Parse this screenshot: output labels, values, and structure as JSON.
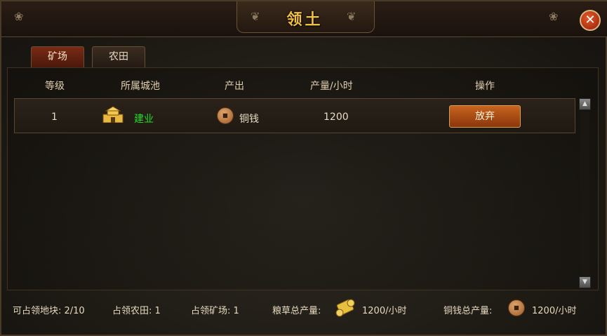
{
  "window": {
    "title": "领土",
    "close_label": "✕"
  },
  "tabs": [
    {
      "label": "矿场",
      "active": true
    },
    {
      "label": "农田",
      "active": false
    }
  ],
  "table": {
    "headers": [
      "等级",
      "所属城池",
      "产出",
      "产量/小时",
      "操作"
    ],
    "rows": [
      {
        "level": "1",
        "city": "建业",
        "output": "铜钱",
        "per_hour": "1200",
        "action": "放弃"
      }
    ]
  },
  "footer": {
    "occupiable_plots": "可占领地块: 2/10",
    "occupied_farms": "占领农田: 1",
    "occupied_mines": "占领矿场: 1",
    "grain_label": "粮草总产量:",
    "grain_value": "1200/小时",
    "copper_label": "铜钱总产量:",
    "copper_value": "1200/小时"
  },
  "colors": {
    "title": "#f2c040",
    "city_name": "#22dd22",
    "button": "#b0521a"
  },
  "icons": [
    "close-icon",
    "city-icon",
    "copper-coin-icon",
    "grain-scroll-icon",
    "arrow-up-icon",
    "arrow-down-icon"
  ]
}
